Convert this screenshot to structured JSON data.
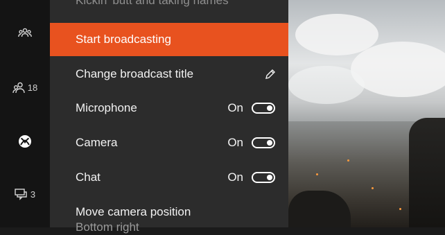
{
  "header": {
    "faded_text": "Kickin' butt and taking names"
  },
  "rail": {
    "items": [
      {
        "icon": "party-icon"
      },
      {
        "icon": "friends-icon",
        "count": "18"
      },
      {
        "icon": "xbox-logo-icon"
      },
      {
        "icon": "messages-icon",
        "count": "3"
      }
    ]
  },
  "menu": {
    "start_broadcasting": "Start broadcasting",
    "change_title": "Change broadcast title",
    "microphone": {
      "label": "Microphone",
      "value": "On"
    },
    "camera": {
      "label": "Camera",
      "value": "On"
    },
    "chat": {
      "label": "Chat",
      "value": "On"
    },
    "move_camera": {
      "label": "Move camera position",
      "value": "Bottom right"
    }
  },
  "colors": {
    "accent": "#e8521f",
    "panel": "#2c2c2c",
    "rail": "#141414"
  }
}
